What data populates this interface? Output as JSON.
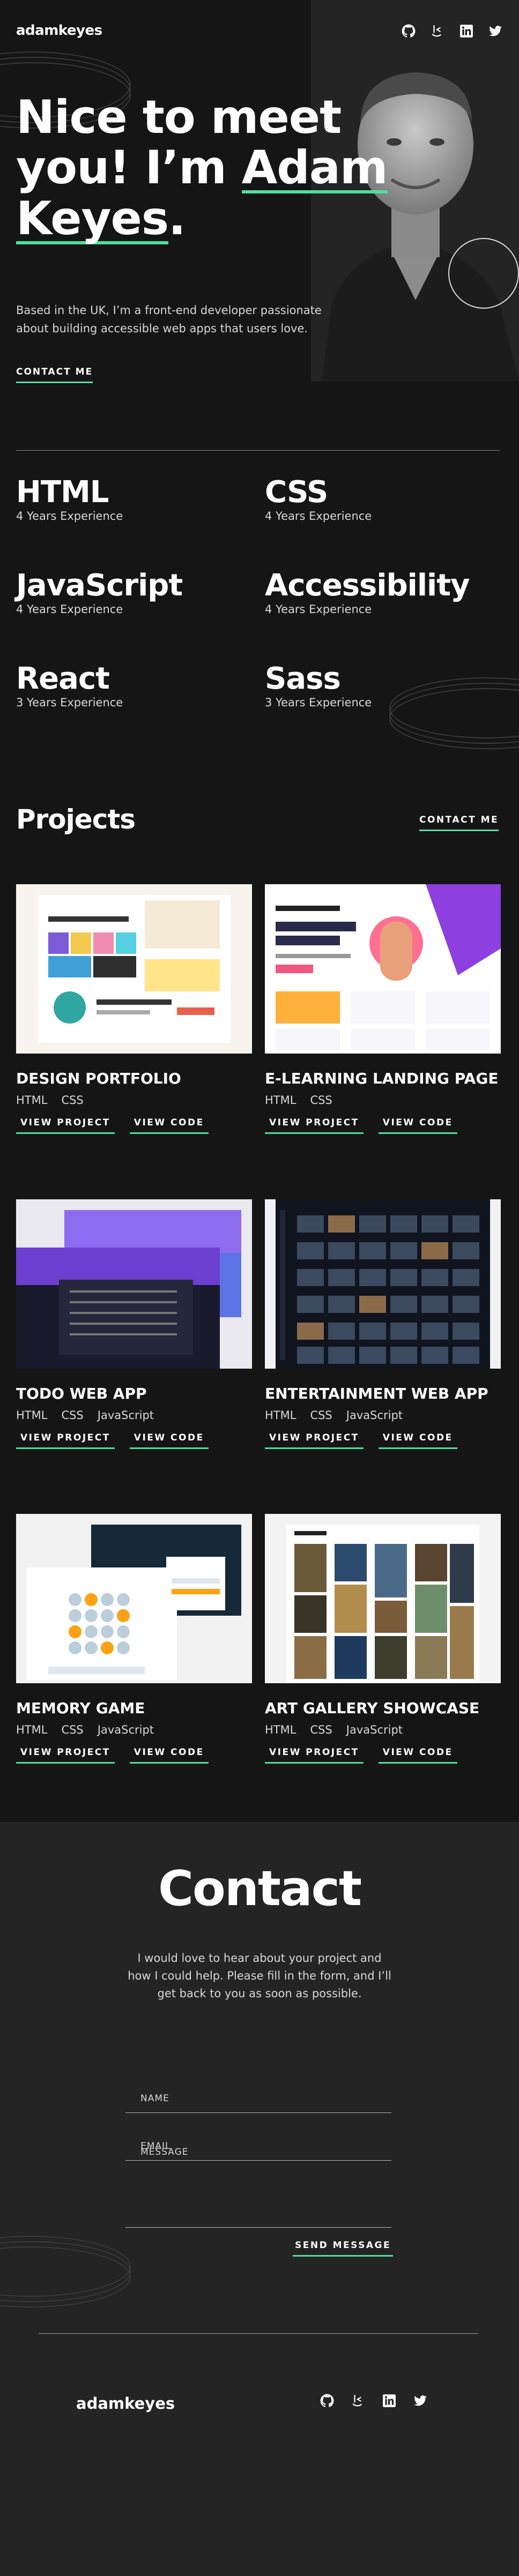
{
  "header": {
    "logo": "adamkeyes",
    "socials": [
      {
        "name": "github",
        "icon": "github-icon"
      },
      {
        "name": "frontend-mentor",
        "icon": "frontend-mentor-icon"
      },
      {
        "name": "linkedin",
        "icon": "linkedin-icon"
      },
      {
        "name": "twitter",
        "icon": "twitter-icon"
      }
    ]
  },
  "hero": {
    "title_part1": "Nice to meet",
    "title_part2": "you! I’m ",
    "title_name_first": "Adam",
    "title_name_last": "Keyes",
    "title_end": ".",
    "text": "Based in the UK, I’m a front-end developer passionate about building accessible web apps that users love.",
    "cta": "CONTACT ME"
  },
  "skills": [
    {
      "name": "HTML",
      "exp": "4 Years Experience"
    },
    {
      "name": "CSS",
      "exp": "4 Years Experience"
    },
    {
      "name": "JavaScript",
      "exp": "4 Years Experience"
    },
    {
      "name": "Accessibility",
      "exp": "4 Years Experience"
    },
    {
      "name": "React",
      "exp": "3 Years Experience"
    },
    {
      "name": "Sass",
      "exp": "3 Years Experience"
    }
  ],
  "projects": {
    "title": "Projects",
    "contact_link": "CONTACT ME",
    "view_project": "VIEW PROJECT",
    "view_code": "VIEW CODE",
    "items": [
      {
        "title": "DESIGN PORTFOLIO",
        "tags": [
          "HTML",
          "CSS"
        ]
      },
      {
        "title": "E-LEARNING LANDING PAGE",
        "tags": [
          "HTML",
          "CSS"
        ]
      },
      {
        "title": "TODO WEB APP",
        "tags": [
          "HTML",
          "CSS",
          "JavaScript"
        ]
      },
      {
        "title": "ENTERTAINMENT WEB APP",
        "tags": [
          "HTML",
          "CSS",
          "JavaScript"
        ]
      },
      {
        "title": "MEMORY GAME",
        "tags": [
          "HTML",
          "CSS",
          "JavaScript"
        ]
      },
      {
        "title": "ART GALLERY SHOWCASE",
        "tags": [
          "HTML",
          "CSS",
          "JavaScript"
        ]
      }
    ]
  },
  "contact": {
    "title": "Contact",
    "text": "I would love to hear about your project and how I could help. Please fill in the form, and I’ll get back to you as soon as possible.",
    "name_placeholder": "NAME",
    "email_placeholder": "EMAIL",
    "message_placeholder": "MESSAGE",
    "send": "SEND MESSAGE"
  },
  "footer": {
    "logo": "adamkeyes"
  },
  "colors": {
    "accent": "#4ee1a0",
    "background": "#151515",
    "panel": "#242424"
  }
}
